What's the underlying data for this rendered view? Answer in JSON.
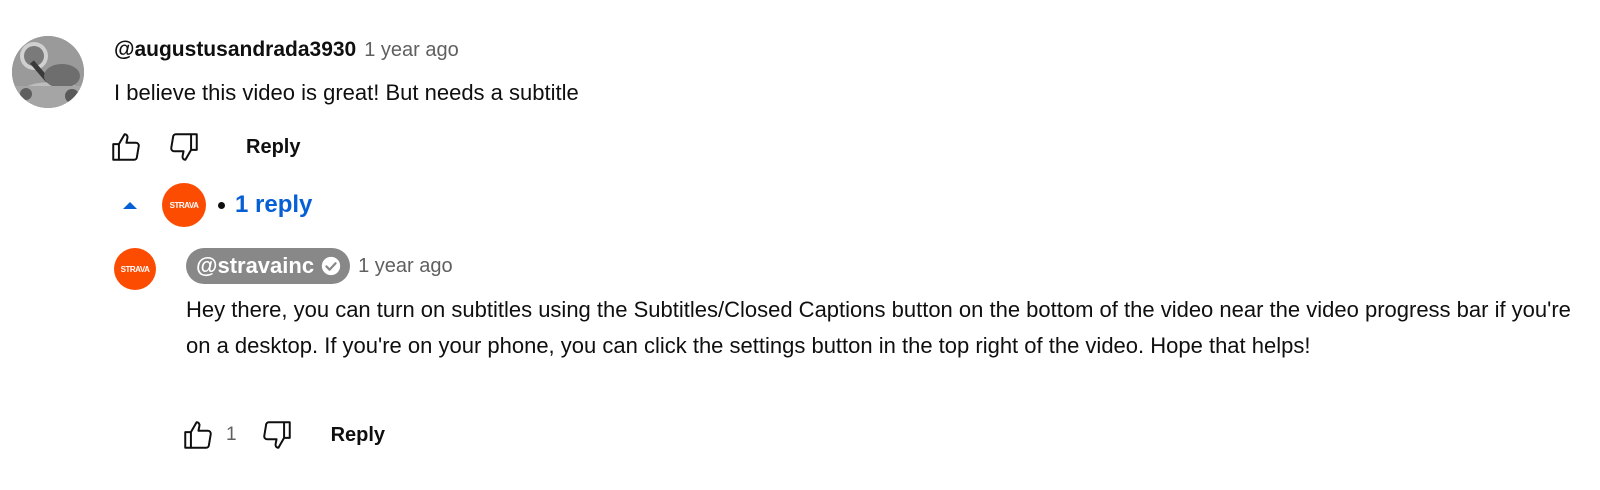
{
  "top_comment": {
    "author": "@augustusandrada3930",
    "time": "1 year ago",
    "text": "I believe this video is great! But needs a subtitle",
    "reply_label": "Reply"
  },
  "replies_toggle": {
    "logo_text": "STRAVA",
    "label": "1 reply"
  },
  "reply": {
    "avatar_text": "STRAVA",
    "author": "@stravainc",
    "time": "1 year ago",
    "text": "Hey there, you can turn on subtitles using the Subtitles/Closed Captions button on the bottom of the video near the video progress bar if you're on a desktop. If you're on your phone, you can click the settings button in the top right of the video. Hope that helps!",
    "like_count": "1",
    "reply_label": "Reply"
  },
  "colors": {
    "link_blue": "#065fd4",
    "strava_orange": "#fc4c02",
    "meta_gray": "#606060",
    "pill_gray": "#888888"
  },
  "icons": [
    "thumbs-up-icon",
    "thumbs-down-icon",
    "caret-up-icon",
    "verified-check-icon"
  ]
}
